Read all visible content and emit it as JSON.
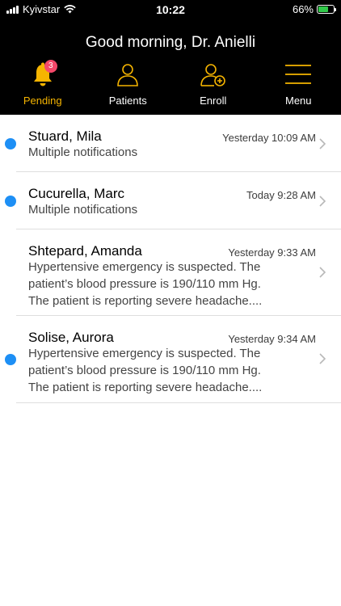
{
  "status_bar": {
    "carrier": "Kyivstar",
    "time": "10:22",
    "battery_percent": "66%",
    "battery_level": 0.66
  },
  "header": {
    "greeting": "Good morning, Dr. Anielli"
  },
  "nav": {
    "items": [
      {
        "label": "Pending",
        "icon": "bell-icon",
        "badge": "3",
        "active": true
      },
      {
        "label": "Patients",
        "icon": "person-icon"
      },
      {
        "label": "Enroll",
        "icon": "add-person-icon"
      },
      {
        "label": "Menu",
        "icon": "hamburger-menu-icon"
      }
    ]
  },
  "notifications": [
    {
      "name": "Stuard, Mila",
      "time": "Yesterday 10:09 AM",
      "desc": "Multiple notifications",
      "unread": true
    },
    {
      "name": "Cucurella, Marc",
      "time": "Today 9:28 AM",
      "desc": "Multiple notifications",
      "unread": true
    },
    {
      "name": "Shtepard, Amanda",
      "time": "Yesterday 9:33 AM",
      "desc": "Hypertensive emergency is suspected. The patient’s blood pressure is 190/110 mm Hg. The patient is reporting severe headache....",
      "unread": false
    },
    {
      "name": "Solise, Aurora",
      "time": "Yesterday 9:34 AM",
      "desc": "Hypertensive emergency is suspected. The patient’s blood pressure is 190/110 mm Hg. The patient is reporting severe headache....",
      "unread": true
    }
  ],
  "colors": {
    "accent": "#f5b400",
    "badge": "#f4486a",
    "unread_dot": "#1d8ff5",
    "header_bg": "#000000"
  }
}
